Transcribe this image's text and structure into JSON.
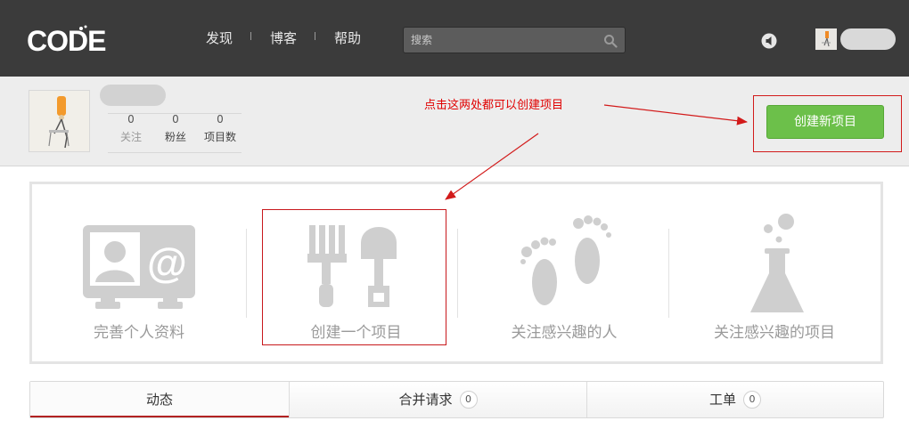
{
  "header": {
    "logo_text": "CODE",
    "nav": [
      {
        "label": "发现"
      },
      {
        "label": "博客"
      },
      {
        "label": "帮助"
      }
    ],
    "search": {
      "placeholder": "搜索",
      "value": ""
    }
  },
  "profile": {
    "stats": [
      {
        "value": "0",
        "label": "关注"
      },
      {
        "value": "0",
        "label": "粉丝"
      },
      {
        "value": "0",
        "label": "项目数"
      }
    ],
    "create_button_label": "创建新项目"
  },
  "annotation": {
    "text": "点击这两处都可以创建项目",
    "color": "#e00000"
  },
  "guides": [
    {
      "label": "完善个人资料",
      "icon": "contact-card-icon"
    },
    {
      "label": "创建一个项目",
      "icon": "garden-tools-icon"
    },
    {
      "label": "关注感兴趣的人",
      "icon": "footprints-icon"
    },
    {
      "label": "关注感兴趣的项目",
      "icon": "lab-flask-icon"
    }
  ],
  "tabs": [
    {
      "label": "动态",
      "count": null,
      "active": true
    },
    {
      "label": "合并请求",
      "count": "0",
      "active": false
    },
    {
      "label": "工单",
      "count": "0",
      "active": false
    }
  ],
  "colors": {
    "topbar": "#3b3b3b",
    "create_button": "#6cc04a",
    "icon_gray": "#cfcfcf",
    "annotation_red": "#d21a1a",
    "tab_active_underline": "#b22222"
  }
}
